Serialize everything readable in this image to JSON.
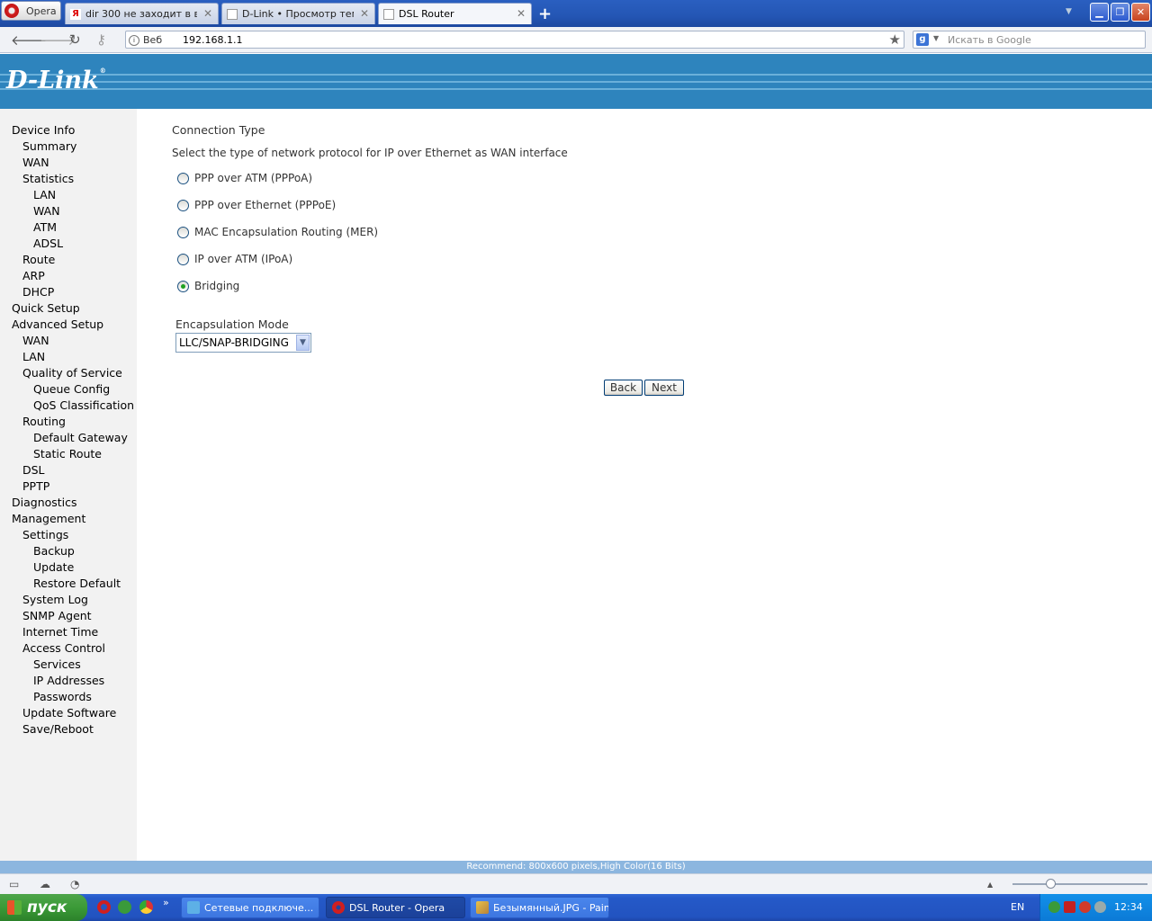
{
  "browser": {
    "menu_label": "Opera",
    "tabs": [
      {
        "title": "dir 300 не заходит в ве..."
      },
      {
        "title": "D-Link • Просмотр темы ..."
      },
      {
        "title": "DSL Router"
      }
    ],
    "address": {
      "prefix": "Веб",
      "url": "192.168.1.1"
    },
    "search_placeholder": "Искать в Google"
  },
  "header": {
    "logo": "D-Link"
  },
  "sidebar": {
    "items": [
      {
        "label": "Device Info",
        "level": 0
      },
      {
        "label": "Summary",
        "level": 1
      },
      {
        "label": "WAN",
        "level": 1
      },
      {
        "label": "Statistics",
        "level": 1
      },
      {
        "label": "LAN",
        "level": 2
      },
      {
        "label": "WAN",
        "level": 2
      },
      {
        "label": "ATM",
        "level": 2
      },
      {
        "label": "ADSL",
        "level": 2
      },
      {
        "label": "Route",
        "level": 1
      },
      {
        "label": "ARP",
        "level": 1
      },
      {
        "label": "DHCP",
        "level": 1
      },
      {
        "label": "Quick Setup",
        "level": 0
      },
      {
        "label": "Advanced Setup",
        "level": 0
      },
      {
        "label": "WAN",
        "level": 1
      },
      {
        "label": "LAN",
        "level": 1
      },
      {
        "label": "Quality of Service",
        "level": 1
      },
      {
        "label": "Queue Config",
        "level": 2
      },
      {
        "label": "QoS Classification",
        "level": 2
      },
      {
        "label": "Routing",
        "level": 1
      },
      {
        "label": "Default Gateway",
        "level": 2
      },
      {
        "label": "Static Route",
        "level": 2
      },
      {
        "label": "DSL",
        "level": 1
      },
      {
        "label": "PPTP",
        "level": 1
      },
      {
        "label": "Diagnostics",
        "level": 0
      },
      {
        "label": "Management",
        "level": 0
      },
      {
        "label": "Settings",
        "level": 1
      },
      {
        "label": "Backup",
        "level": 2
      },
      {
        "label": "Update",
        "level": 2
      },
      {
        "label": "Restore Default",
        "level": 2
      },
      {
        "label": "System Log",
        "level": 1
      },
      {
        "label": "SNMP Agent",
        "level": 1
      },
      {
        "label": "Internet Time",
        "level": 1
      },
      {
        "label": "Access Control",
        "level": 1
      },
      {
        "label": "Services",
        "level": 2
      },
      {
        "label": "IP Addresses",
        "level": 2
      },
      {
        "label": "Passwords",
        "level": 2
      },
      {
        "label": "Update Software",
        "level": 1
      },
      {
        "label": "Save/Reboot",
        "level": 1
      }
    ]
  },
  "main": {
    "title": "Connection Type",
    "description": "Select the type of network protocol for IP over Ethernet as WAN interface",
    "options": [
      {
        "label": "PPP over ATM (PPPoA)",
        "checked": false
      },
      {
        "label": "PPP over Ethernet (PPPoE)",
        "checked": false
      },
      {
        "label": "MAC Encapsulation Routing (MER)",
        "checked": false
      },
      {
        "label": "IP over ATM (IPoA)",
        "checked": false
      },
      {
        "label": "Bridging",
        "checked": true
      }
    ],
    "encapsulation_label": "Encapsulation Mode",
    "encapsulation_value": "LLC/SNAP-BRIDGING",
    "back_label": "Back",
    "next_label": "Next"
  },
  "footer_note": "Recommend: 800x600 pixels,High Color(16 Bits)",
  "taskbar": {
    "start_label": "пуск",
    "tasks": [
      {
        "label": "Сетевые подключе..."
      },
      {
        "label": "DSL Router - Opera"
      },
      {
        "label": "Безымянный.JPG - Paint"
      }
    ],
    "language": "EN",
    "clock": "12:34"
  },
  "colors": {
    "header_blue": "#2e84bd",
    "sidebar_bg": "#f2f2f2",
    "taskbar_blue": "#2559c8",
    "start_green": "#3b9a37"
  }
}
